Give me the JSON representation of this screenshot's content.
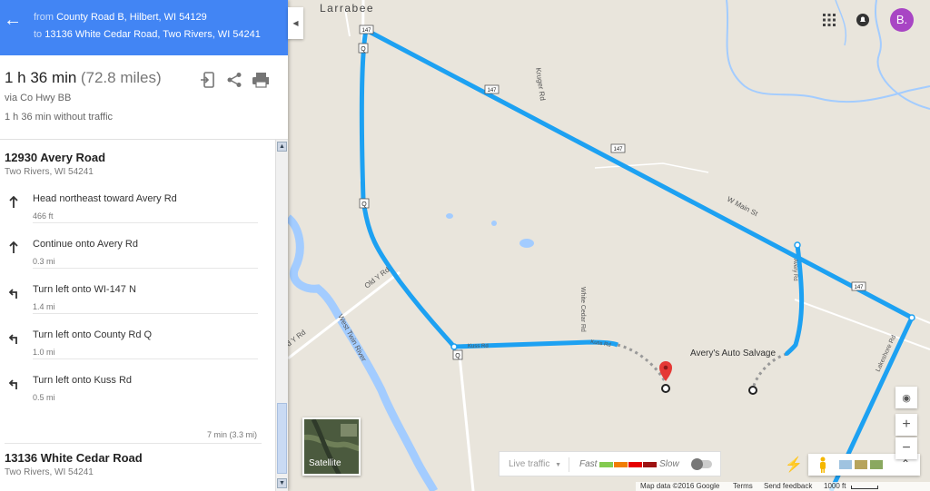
{
  "header": {
    "from_prefix": "from",
    "from_value": "County Road B, Hilbert, WI 54129",
    "to_prefix": "to",
    "to_value": "13136 White Cedar Road, Two Rivers, WI 54241"
  },
  "summary": {
    "time": "1 h 36 min",
    "distance": "(72.8 miles)",
    "via": "via Co Hwy BB",
    "no_traffic": "1 h 36 min without traffic"
  },
  "start": {
    "address": "12930 Avery Road",
    "city": "Two Rivers, WI 54241"
  },
  "steps": [
    {
      "icon": "arrow-up-icon",
      "text": "Head northeast toward Avery Rd",
      "dist": "466 ft"
    },
    {
      "icon": "arrow-up-icon",
      "text": "Continue onto Avery Rd",
      "dist": "0.3 mi"
    },
    {
      "icon": "turn-left-icon",
      "text": "Turn left onto WI-147 N",
      "dist": "1.4 mi"
    },
    {
      "icon": "turn-left-icon",
      "text": "Turn left onto County Rd Q",
      "dist": "1.0 mi"
    },
    {
      "icon": "turn-left-icon",
      "text": "Turn left onto Kuss Rd",
      "dist": "0.5 mi"
    }
  ],
  "total": "7 min (3.3 mi)",
  "end": {
    "address": "13136 White Cedar Road",
    "city": "Two Rivers, WI 54241"
  },
  "map": {
    "place_labels": {
      "larrabee": "Larrabee",
      "kruger": "Kruger Rd",
      "w_main": "W Main St",
      "white_cedar": "White Cedar Rd",
      "old_y_rd": "Old Y Rd",
      "d_y_rd": "d Y Rd",
      "west_twin": "West Twin River",
      "kuss_rd": "Kuss Rd",
      "kuss_rd2": "Kuss Rd",
      "averys": "Avery's Auto Salvage",
      "avery_rd": "Avery Rd",
      "lakeshore": "Lakeshore Rd"
    },
    "shields": {
      "s147a": "147",
      "s147b": "147",
      "s147c": "147",
      "s147d": "147",
      "q1": "Q",
      "q2": "Q",
      "q3": "Q"
    },
    "avatar_letter": "B.",
    "satellite": "Satellite",
    "traffic": {
      "live": "Live traffic",
      "fast": "Fast",
      "slow": "Slow"
    },
    "footer": {
      "mapdata": "Map data ©2016 Google",
      "terms": "Terms",
      "feedback": "Send feedback",
      "scale": "1000 ft"
    },
    "colors": {
      "route": "#1da1f2",
      "water": "#a3ccff",
      "land": "#e9e5dc",
      "road": "#ffffff",
      "header": "#4285f4",
      "pin": "#e53935"
    }
  }
}
